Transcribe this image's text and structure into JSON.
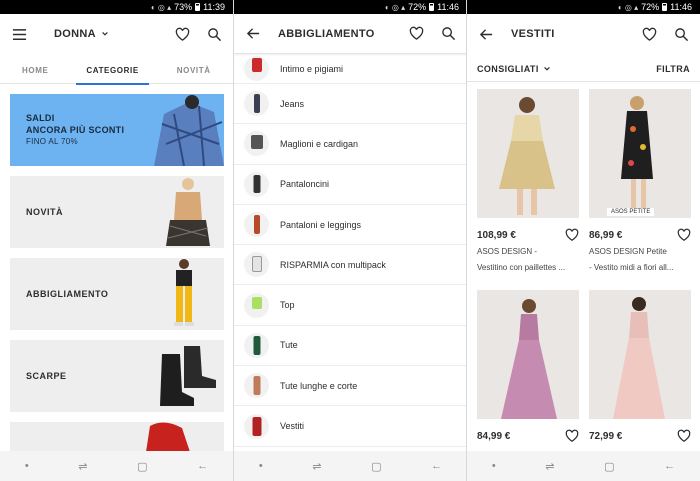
{
  "colors": {
    "accent": "#2d72d9",
    "saldi_bg": "#6db3f2"
  },
  "status": [
    {
      "battery": "73%",
      "time": "11:39"
    },
    {
      "battery": "72%",
      "time": "11:46"
    },
    {
      "battery": "72%",
      "time": "11:46"
    }
  ],
  "panel1": {
    "title": "DONNA",
    "tabs": [
      "HOME",
      "CATEGORIE",
      "NOVITÀ"
    ],
    "active_tab": "CATEGORIE",
    "saldi": {
      "line1": "SALDI",
      "line2": "ANCORA PIÙ SCONTI",
      "line3": "FINO AL 70%"
    },
    "banners": [
      "NOVITÀ",
      "ABBIGLIAMENTO",
      "SCARPE"
    ]
  },
  "panel2": {
    "title": "ABBIGLIAMENTO",
    "items": [
      "Intimo e pigiami",
      "Jeans",
      "Maglioni e cardigan",
      "Pantaloncini",
      "Pantaloni e leggings",
      "RISPARMIA con multipack",
      "Top",
      "Tute",
      "Tute lunghe e corte",
      "Vestiti"
    ]
  },
  "panel3": {
    "title": "VESTITI",
    "sort_label": "CONSIGLIATI",
    "filter_label": "FILTRA",
    "products": [
      {
        "price": "108,99 €",
        "name1": "ASOS DESIGN -",
        "name2": "Vestitino con paillettes ..."
      },
      {
        "price": "86,99 €",
        "name1": "ASOS DESIGN Petite",
        "name2": "- Vestito midi a fiori all...",
        "badge": "ASOS PETITE"
      },
      {
        "price": "84,99 €"
      },
      {
        "price": "72,99 €"
      }
    ]
  },
  "icons": [
    "menu-icon",
    "chevron-down-icon",
    "heart-icon",
    "search-icon",
    "back-arrow-icon"
  ]
}
